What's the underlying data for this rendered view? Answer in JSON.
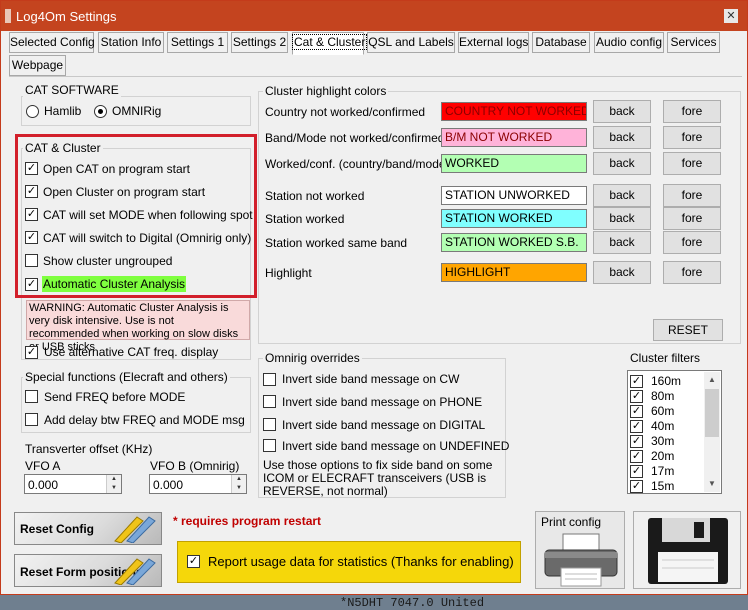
{
  "window": {
    "title": "Log4Om Settings",
    "close": "✕"
  },
  "tabs": [
    {
      "label": "Selected Config"
    },
    {
      "label": "Station Info"
    },
    {
      "label": "Settings 1"
    },
    {
      "label": "Settings 2"
    },
    {
      "label": "Cat & Cluster",
      "active": true
    },
    {
      "label": "QSL and Labels"
    },
    {
      "label": "External logs"
    },
    {
      "label": "Database"
    },
    {
      "label": "Audio config"
    },
    {
      "label": "Services"
    },
    {
      "label": "Webpage"
    }
  ],
  "cat_software": {
    "title": "CAT SOFTWARE",
    "options": [
      "Hamlib",
      "OMNIRig"
    ],
    "selected": "OMNIRig"
  },
  "cat_cluster": {
    "title": "CAT & Cluster",
    "items": [
      {
        "label": "Open CAT on program start",
        "checked": true
      },
      {
        "label": "Open Cluster on program start",
        "checked": true
      },
      {
        "label": "CAT will set MODE when following spot",
        "checked": true
      },
      {
        "label": "CAT will switch to Digital (Omnirig only)",
        "checked": true
      },
      {
        "label": "Show cluster ungrouped",
        "checked": false
      },
      {
        "label": "Automatic Cluster Analysis",
        "checked": true,
        "highlight": "#7fff3f"
      }
    ],
    "warning": "WARNING: Automatic Cluster Analysis is very disk intensive. Use is not recommended when working on slow disks or USB sticks",
    "alt_freq": {
      "label": "Use alternative CAT freq. display",
      "checked": true
    }
  },
  "special": {
    "title": "Special functions (Elecraft and others)",
    "items": [
      {
        "label": "Send FREQ before MODE",
        "checked": false
      },
      {
        "label": "Add delay btw FREQ and MODE msg",
        "checked": false
      }
    ],
    "transverter_label": "Transverter offset (KHz)",
    "vfo_a_label": "VFO A",
    "vfo_a_value": "0.000",
    "vfo_b_label": "VFO B (Omnirig)",
    "vfo_b_value": "0.000"
  },
  "highlight_colors": {
    "title": "Cluster highlight colors",
    "back_label": "back",
    "fore_label": "fore",
    "reset_label": "RESET",
    "rows": [
      {
        "label": "Country not worked/confirmed",
        "sample": "COUNTRY NOT WORKED",
        "bg": "#ff0000",
        "fg": "#8b0000"
      },
      {
        "label": "Band/Mode not worked/confirmed",
        "sample": "B/M NOT WORKED",
        "bg": "#ffb3d9",
        "fg": "#8b0000"
      },
      {
        "label": "Worked/conf. (country/band/mode)",
        "sample": "WORKED",
        "bg": "#b3ffb3",
        "fg": "#000000"
      },
      {
        "label": "Station not worked",
        "sample": "STATION UNWORKED",
        "bg": "#ffffff",
        "fg": "#000000"
      },
      {
        "label": "Station worked",
        "sample": "STATION WORKED",
        "bg": "#80ffff",
        "fg": "#000000"
      },
      {
        "label": "Station worked same band",
        "sample": "STATION WORKED S.B.",
        "bg": "#b3ffb3",
        "fg": "#000000"
      },
      {
        "label": "Highlight",
        "sample": "HIGHLIGHT",
        "bg": "#ffa500",
        "fg": "#000000"
      }
    ]
  },
  "omnirig": {
    "title": "Omnirig overrides",
    "items": [
      {
        "label": "Invert side band message on CW",
        "checked": false
      },
      {
        "label": "Invert side band message on PHONE",
        "checked": false
      },
      {
        "label": "Invert side band message on DIGITAL",
        "checked": false
      },
      {
        "label": "Invert side band message on UNDEFINED",
        "checked": false
      }
    ],
    "note": "Use those options to fix side band on some ICOM or ELECRAFT transceivers (USB is REVERSE, not normal)"
  },
  "cluster_filters": {
    "title": "Cluster filters",
    "items": [
      {
        "label": "160m",
        "checked": true
      },
      {
        "label": "80m",
        "checked": true
      },
      {
        "label": "60m",
        "checked": true
      },
      {
        "label": "40m",
        "checked": true
      },
      {
        "label": "30m",
        "checked": true
      },
      {
        "label": "20m",
        "checked": true
      },
      {
        "label": "17m",
        "checked": true
      },
      {
        "label": "15m",
        "checked": true
      }
    ]
  },
  "buttons": {
    "reset_config": "Reset Config",
    "reset_positions": "Reset Form positions",
    "restart_note": "* requires program restart",
    "print_config": "Print config"
  },
  "stats": {
    "label": "Report usage data for statistics (Thanks for enabling)",
    "checked": true
  },
  "background_text": "*N5DHT        7047.0 United"
}
